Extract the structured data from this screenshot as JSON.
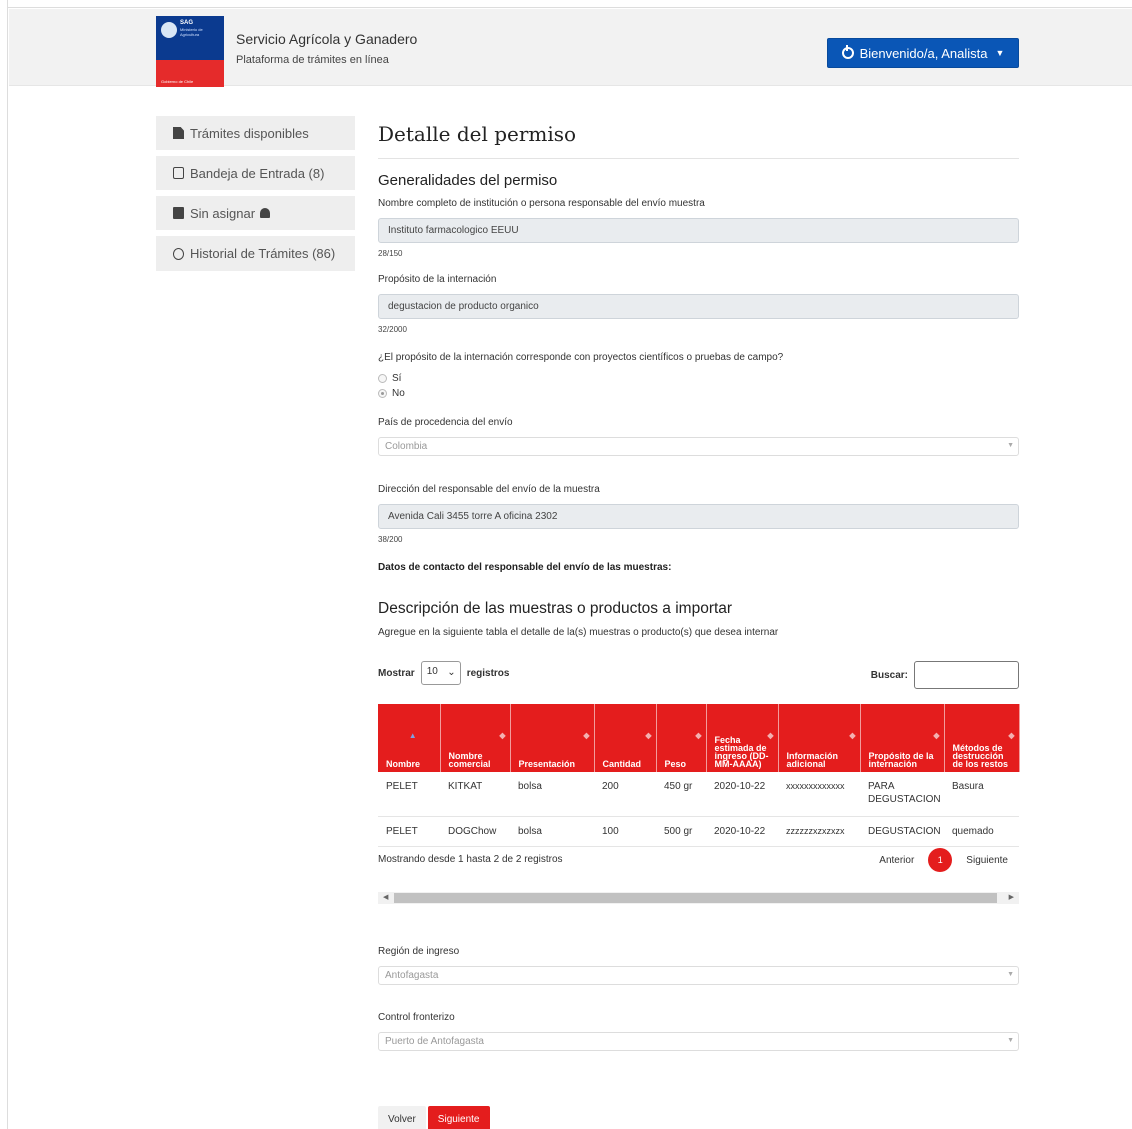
{
  "header": {
    "logo_abbr": "SAG",
    "logo_ministry": "Ministerio de Agricultura",
    "logo_gob": "Gobierno de Chile",
    "title": "Servicio Agrícola y Ganadero",
    "subtitle": "Plataforma de trámites en línea",
    "user_label": "Bienvenido/a, Analista"
  },
  "sidebar": {
    "items": [
      {
        "label": "Trámites disponibles",
        "icon": "document-icon"
      },
      {
        "label": "Bandeja de Entrada (8)",
        "icon": "inbox-icon"
      },
      {
        "label": "Sin asignar",
        "icon": "clipboard-icon"
      },
      {
        "label": "Historial de Trámites (86)",
        "icon": "history-icon"
      }
    ]
  },
  "page": {
    "title": "Detalle del permiso",
    "section1": "Generalidades del permiso",
    "f1_label": "Nombre completo de institución o persona responsable del envío muestra",
    "f1_value": "Instituto farmacologico EEUU",
    "f1_count": "28/150",
    "f2_label": "Propósito de la internación",
    "f2_value": "degustacion de producto organico",
    "f2_count": "32/2000",
    "q_label": "¿El propósito de la internación corresponde con proyectos científicos o pruebas de campo?",
    "q_yes": "Sí",
    "q_no": "No",
    "country_label": "País de procedencia del envío",
    "country_value": "Colombia",
    "addr_label": "Dirección del responsable del envío de la muestra",
    "addr_value": "Avenida Cali 3455 torre A oficina 2302",
    "addr_count": "38/200",
    "contact_label": "Datos de contacto del responsable del envío de las muestras:",
    "section2": "Descripción de las muestras o productos a importar",
    "section2_sub": "Agregue en la siguiente tabla el detalle de la(s) muestras o producto(s) que desea internar",
    "show_label": "Mostrar",
    "show_value": "10",
    "records_label": "registros",
    "search_label": "Buscar:",
    "info": "Mostrando desde 1 hasta 2 de 2 registros",
    "prev": "Anterior",
    "page_num": "1",
    "next": "Siguiente",
    "region_label": "Región de ingreso",
    "region_value": "Antofagasta",
    "border_label": "Control fronterizo",
    "border_value": "Puerto de Antofagasta",
    "btn_back": "Volver",
    "btn_next": "Siguiente"
  },
  "table": {
    "headers": [
      "Nombre",
      "Nombre comercial",
      "Presentación",
      "Cantidad",
      "Peso",
      "Fecha estimada de ingreso (DD-MM-AAAA)",
      "Información adicional",
      "Propósito de la internación",
      "Métodos de destrucción de los restos"
    ],
    "rows": [
      [
        "PELET",
        "KITKAT",
        "bolsa",
        "200",
        "450 gr",
        "2020-10-22",
        "xxxxxxxxxxxxx",
        "PARA DEGUSTACION",
        "Basura"
      ],
      [
        "PELET",
        "DOGChow",
        "bolsa",
        "100",
        "500 gr",
        "2020-10-22",
        "zzzzzzxzxzxzx",
        "DEGUSTACION",
        "quemado"
      ]
    ]
  },
  "colors": {
    "accent_red": "#e41d1d",
    "brand_blue": "#0a56b6"
  }
}
